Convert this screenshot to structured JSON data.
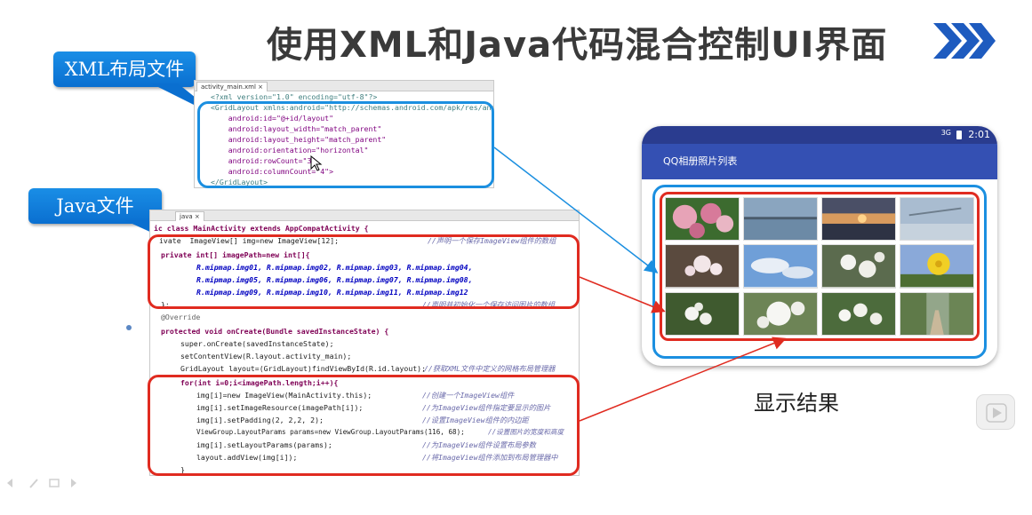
{
  "title": "使用XML和Java代码混合控制UI界面",
  "callouts": {
    "xml": "XML布局文件",
    "java": "Java文件"
  },
  "xml_panel": {
    "tab_label": "activity_main.xml",
    "tab_close": "×",
    "lines": [
      "<?xml version=\"1.0\" encoding=\"utf-8\"?>",
      "<GridLayout xmlns:android=\"http://schemas.android.com/apk/res/android\"",
      "    android:id=\"@+id/layout\"",
      "    android:layout_width=\"match_parent\"",
      "    android:layout_height=\"match_parent\"",
      "    android:orientation=\"horizontal\"",
      "    android:rowCount=\"3\"",
      "    android:columnCount=\"4\">",
      "</GridLayout>"
    ]
  },
  "java_panel": {
    "tab_label": "java",
    "tab_close": "×",
    "line1": "ic class MainActivity extends AppCompatActivity {",
    "line2": "ivate  ImageView[] img=new ImageView[12];",
    "line2_comment": "//声明一个保存ImageView组件的数组",
    "line3": "private int[] imagePath=new int[]{",
    "line4": "R.mipmap.img01, R.mipmap.img02, R.mipmap.img03, R.mipmap.img04,",
    "line5": "R.mipmap.img05, R.mipmap.img06, R.mipmap.img07, R.mipmap.img08,",
    "line6": "R.mipmap.img09, R.mipmap.img10, R.mipmap.img11, R.mipmap.img12",
    "line7": "};",
    "line7_comment": "//声明并初始化一个保存访问图片的数组",
    "line8": "@Override",
    "line9": "protected void onCreate(Bundle savedInstanceState) {",
    "line10": "super.onCreate(savedInstanceState);",
    "line11": "setContentView(R.layout.activity_main);",
    "line12": "GridLayout layout=(GridLayout)findViewById(R.id.layout);",
    "line12_comment": "//获取XML文件中定义的网格布局管理器",
    "line13": "for(int i=0;i<imagePath.length;i++){",
    "line14": "img[i]=new ImageView(MainActivity.this);",
    "line14_comment": "//创建一个ImageView组件",
    "line15": "img[i].setImageResource(imagePath[i]);",
    "line15_comment": "//为ImageView组件指定要显示的图片",
    "line16": "img[i].setPadding(2, 2,2, 2);",
    "line16_comment": "//设置ImageView组件的内边距",
    "line17": "ViewGroup.LayoutParams params=new ViewGroup.LayoutParams(116, 68);",
    "line17_comment": "//设置图片的宽度和高度",
    "line18": "img[i].setLayoutParams(params);",
    "line18_comment": "//为ImageView组件设置布局参数",
    "line19": "layout.addView(img[i]);",
    "line19_comment": "//将ImageView组件添加到布局管理器中",
    "line20": "}"
  },
  "phone": {
    "signal": "3G",
    "time": "2:01",
    "app_title": "QQ相册照片列表"
  },
  "result_label": "显示结果",
  "colors": {
    "accent_blue": "#1b8fe0",
    "highlight_red": "#e02b20",
    "appbar": "#3450b3",
    "statusbar": "#2a3c8f"
  }
}
